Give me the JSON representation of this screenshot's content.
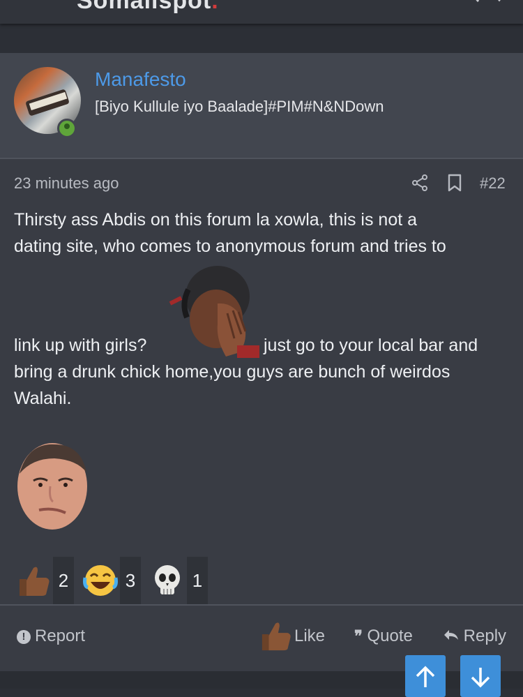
{
  "header": {
    "logo_text": "Somalispot",
    "logo_dot": "."
  },
  "post": {
    "username": "Manafesto",
    "user_title": "[Biyo Kullule iyo Baalade]#PIM#N&NDown",
    "timestamp": "23 minutes ago",
    "post_number": "#22",
    "body": {
      "line1": "Thirsty ass Abdis on this forum la xowla, this is not a",
      "line2": "dating site, who comes to anonymous forum and tries to",
      "line3a": "link up with girls?",
      "line3b": "just go to your local bar and",
      "line4": "bring a drunk chick home,you guys are bunch of weirdos",
      "line5": "Walahi."
    },
    "reactions": [
      {
        "icon": "thumbs-up-icon",
        "count": "2"
      },
      {
        "icon": "laughing-crying-icon",
        "count": "3"
      },
      {
        "icon": "skull-icon",
        "count": "1"
      }
    ],
    "actions": {
      "report": "Report",
      "like": "Like",
      "quote": "Quote",
      "reply": "Reply"
    }
  },
  "colors": {
    "accent": "#4d9ae8",
    "background": "#2c2f36",
    "post_bg": "#393c44",
    "online": "#5fa53a",
    "nav_button": "#3e8fd9"
  }
}
